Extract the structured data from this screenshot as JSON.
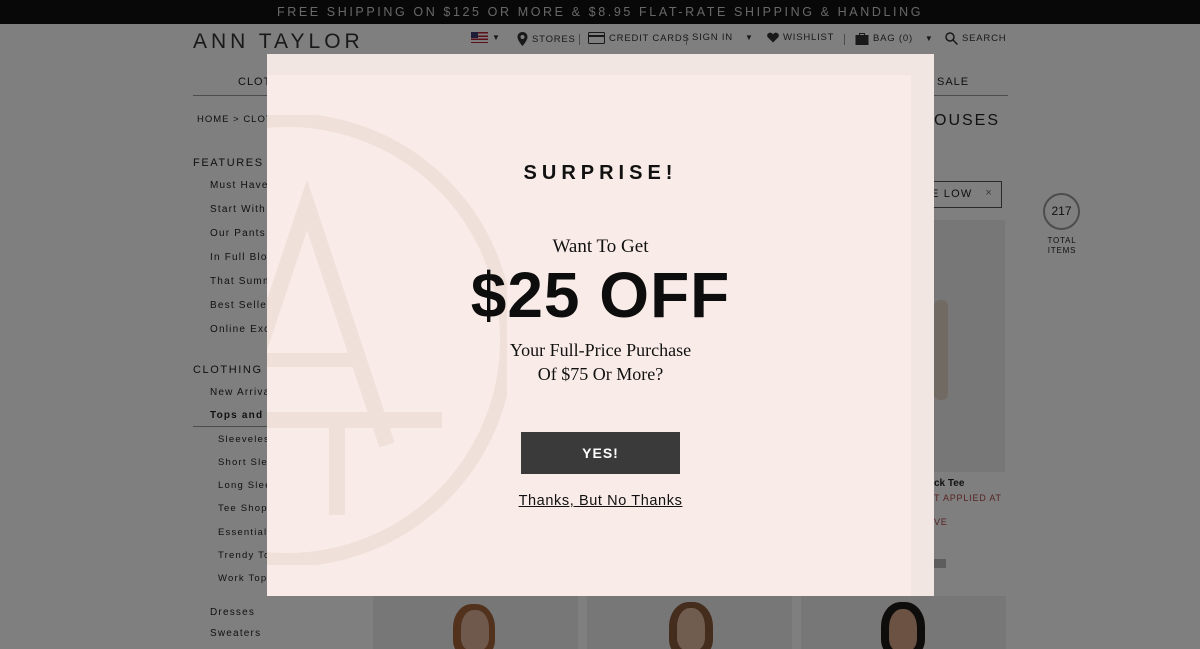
{
  "promo_bar": "FREE SHIPPING ON $125 OR MORE & $8.95 FLAT-RATE SHIPPING & HANDLING",
  "header": {
    "logo": "ANN TAYLOR",
    "stores": "STORES",
    "credit_cards": "CREDIT CARDS",
    "sign_in": "SIGN IN",
    "wishlist": "WISHLIST",
    "bag": "BAG (0)",
    "search": "SEARCH"
  },
  "nav": {
    "clothing_partial": "CLOT",
    "sale": "SALE"
  },
  "breadcrumb": "HOME  >  CLOT",
  "category_title_partial": "OUSES",
  "sidebar": {
    "features_heading": "FEATURES",
    "features": [
      "Must Have",
      "Start With",
      "Our Pants",
      "In Full Blo",
      "That Summ",
      "Best Seller",
      "Online Exc"
    ],
    "clothing_heading": "CLOTHING",
    "clothing": [
      "New Arriva",
      "Tops and B"
    ],
    "tops_sub": [
      "Sleeveless",
      "Short Slee",
      "Long Slee",
      "Tee Shop",
      "Essential",
      "Trendy To",
      "Work Tops"
    ],
    "more": [
      "Dresses",
      "Sweaters"
    ]
  },
  "sort": {
    "label": "E LOW",
    "clear": "×"
  },
  "total": {
    "count": "217",
    "label_line1": "TOTAL",
    "label_line2": "ITEMS"
  },
  "product": {
    "name_partial": "ck Tee",
    "promo_partial": "T APPLIED AT",
    "promo2_partial": "VE"
  },
  "modal": {
    "eyebrow": "SURPRISE!",
    "want": "Want To Get",
    "amount": "$25 OFF",
    "desc_line1": "Your Full-Price Purchase",
    "desc_line2": "Of $75 Or More?",
    "yes": "YES!",
    "no": "Thanks, But No Thanks"
  },
  "colors": {
    "modal_bg": "#f9ece8",
    "button_bg": "#3a3a3a",
    "overlay": "rgba(0,0,0,0.5)"
  },
  "icons": [
    "us-flag-icon",
    "location-pin-icon",
    "credit-card-icon",
    "heart-icon",
    "shopping-bag-icon",
    "search-icon",
    "close-icon",
    "monogram-watermark"
  ]
}
